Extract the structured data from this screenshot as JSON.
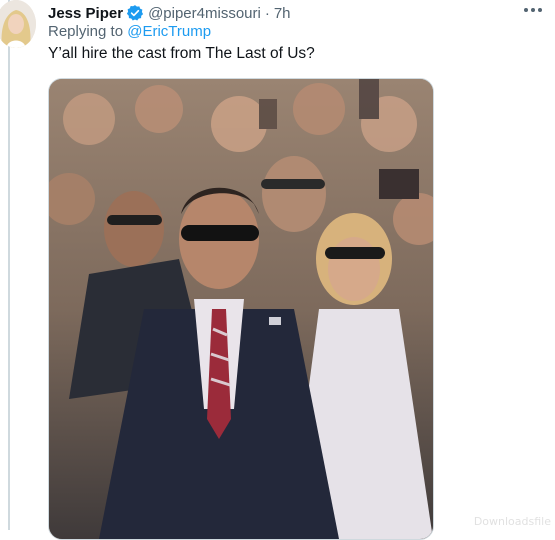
{
  "tweet": {
    "author_name": "Jess Piper",
    "handle": "@piper4missouri",
    "separator": "·",
    "time": "7h",
    "replying_prefix": "Replying to",
    "replying_to": "@EricTrump",
    "text": "Y’all hire the cast from The Last of Us?",
    "verified_icon": "verified-badge-icon",
    "more_icon": "more-options-icon"
  },
  "colors": {
    "link": "#1d9bf0",
    "secondary_text": "#536471",
    "primary_text": "#0f1419",
    "thread_line": "#cfd9de"
  },
  "watermark": "Downloadsfile"
}
